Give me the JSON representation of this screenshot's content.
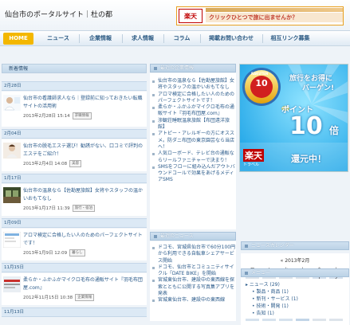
{
  "header": {
    "site_title": "仙台市のポータルサイト｜杜の都",
    "banner_logo": "楽天",
    "banner_text": "クリックひとつで旅に出ませんか？"
  },
  "nav": [
    "HOME",
    "ニュース",
    "企業情報",
    "求人情報",
    "コラム",
    "掲載お問い合わせ",
    "相互リンク募集"
  ],
  "left": {
    "heading": "新着情報",
    "groups": [
      {
        "date": "2月28日",
        "title": "仙台市の看護師求人なら｜登録前に知っておきたい転職サイトの活用術",
        "meta": "2013年2月28日 15:14",
        "badge": "求職情報"
      },
      {
        "date": "2月04日",
        "title": "仙台市の脱毛エステ選び！勧誘がない、口コミで評判のエステをご紹介！",
        "meta": "2013年2月4日 14:08",
        "badge": "美容"
      },
      {
        "date": "1月17日",
        "title": "仙台市の温泉なら【佐勘屋旅館】女将やスタッフの温かいおもてなし",
        "meta": "2013年1月17日 11:39",
        "badge": "旅行・宿泊"
      },
      {
        "date": "1月09日",
        "title": "アロマ検定に合格したい人のためのパーフェクトサイトです！",
        "meta": "2013年1月9日 12:09",
        "badge": "暮らし"
      },
      {
        "date": "11月15日",
        "title": "柔らか・ふかふかマイクロ毛布の通販サイト『羽毛布団屋.com』",
        "meta": "2012年11月15日 10:38",
        "badge": "企業情報"
      },
      {
        "date": "11月13日",
        "title": "",
        "meta": "",
        "badge": ""
      }
    ]
  },
  "mid": {
    "company_heading": "最近の企業情報",
    "company_items": [
      "仙台市の温泉なら【佐勘屋旅館】女将やスタッフの温かいおもてなし",
      "アロマ検定に合格したい人のためのパーフェクトサイトです！",
      "柔らか・ふかふかマイクロ毛布の通販サイト『羽毛布団屋.com』",
      "渉観荘睡眠温泉旅館【布団遠洋旅館】",
      "アトピー・アレルギーの方にオススメ。防ダニ布団の東京園芸なら当店へ！",
      "人気ローボード、テレビ台の通販ならリールファニチャーで決まり！",
      "SMSをフローに組み込んだアウトバウンドコールで効果をあげるメディアSMS"
    ],
    "news_heading": "最近のニュース",
    "news_items": [
      "ドコモ、宮城県仙台市で60分100円から利用できる自転車シェアサービス開始",
      "ドコモ、仙台市とコミュニティサイクル「DATE BIKE」を開始",
      "宮城東仙台市、建設中の東西線を探索とともに公開する写真集アプリを発表",
      "宮城東仙台市、建設中の東西線"
    ]
  },
  "right": {
    "ad": {
      "medal_top": "RAKUTEN",
      "medal_num": "10",
      "headline1": "旅行をお得に",
      "headline2": "バーゲン!",
      "point_label": "ポイント",
      "big_num": "10",
      "bai": "倍",
      "logo": "楽天",
      "logo2": "トラベル",
      "kangen": "還元中！"
    },
    "calendar_heading": "ニュースカレンダー",
    "calendar": {
      "title": "« 2013年2月",
      "weekdays": [
        "月",
        "火",
        "水",
        "木",
        "金",
        "土"
      ],
      "weeks": [
        [
          "",
          "",
          "",
          "",
          "1",
          "2"
        ],
        [
          "4",
          "5",
          "6",
          "7",
          "8",
          "9"
        ],
        [
          "11",
          "12",
          "13",
          "14",
          "15",
          "16"
        ],
        [
          "18",
          "19",
          "20",
          "21",
          "22",
          "23"
        ],
        [
          "25",
          "26",
          "27",
          "28",
          "",
          ""
        ]
      ]
    },
    "menu_heading": "メニュー",
    "menu_items": [
      "ニュース (29)",
      "製品・商品 (1)",
      "新刊・サービス (1)",
      "技術・開発 (1)",
      "告知 (1)"
    ]
  }
}
